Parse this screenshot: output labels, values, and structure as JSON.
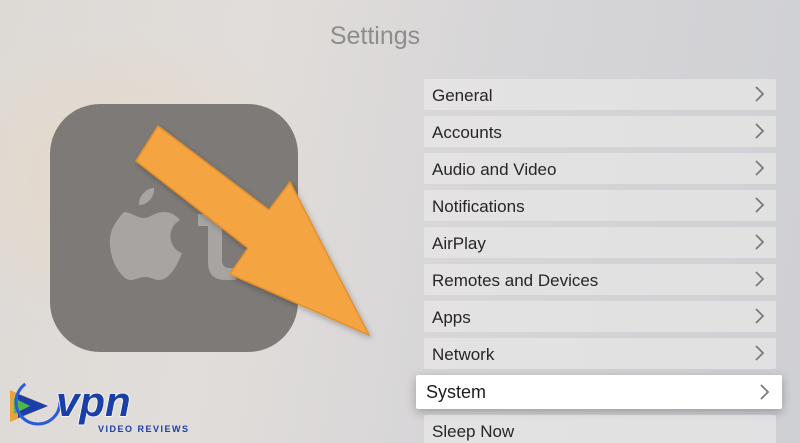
{
  "page": {
    "title": "Settings"
  },
  "menu": {
    "items": [
      {
        "label": "General"
      },
      {
        "label": "Accounts"
      },
      {
        "label": "Audio and Video"
      },
      {
        "label": "Notifications"
      },
      {
        "label": "AirPlay"
      },
      {
        "label": "Remotes and Devices"
      },
      {
        "label": "Apps"
      },
      {
        "label": "Network"
      },
      {
        "label": "System",
        "focused": true
      },
      {
        "label": "Sleep Now"
      }
    ]
  },
  "logo": {
    "text": "vpn",
    "tagline": "VIDEO REVIEWS"
  },
  "icons": {
    "tv": "apple-tv-icon",
    "chevron": "chevron-right-icon",
    "arrow": "orange-arrow"
  },
  "colors": {
    "arrow": "#f5a443",
    "logo_blue": "#1b3fa8",
    "focus_bg": "#ffffff"
  }
}
